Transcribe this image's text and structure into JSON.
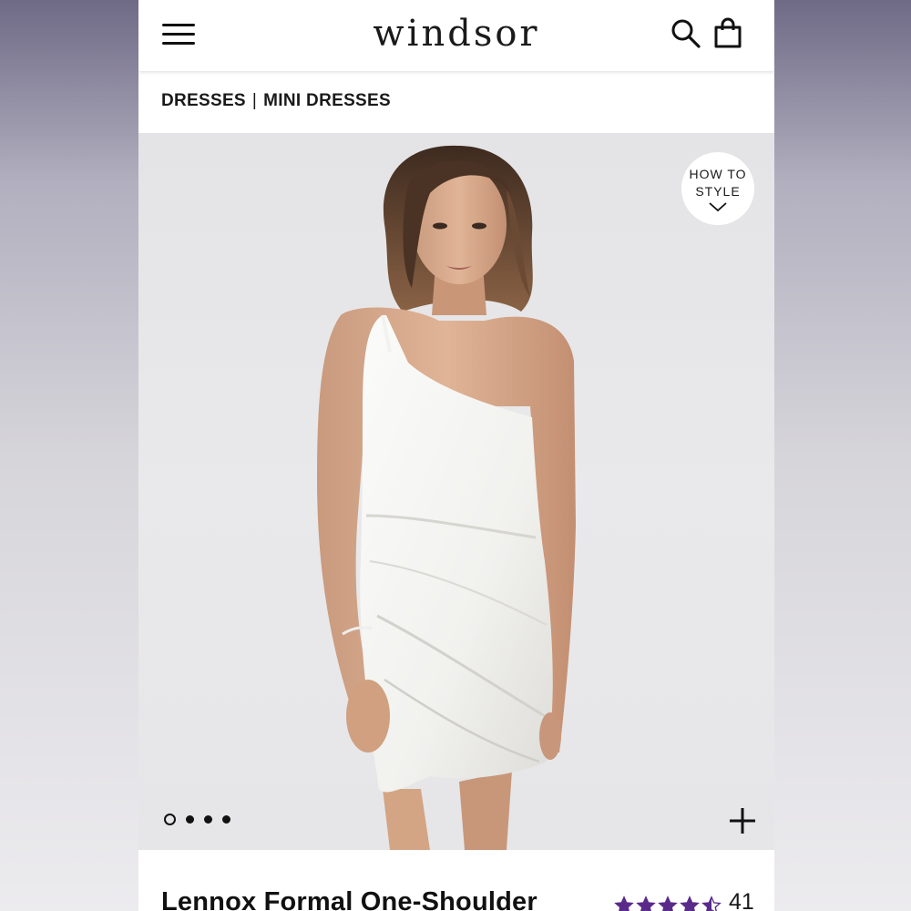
{
  "header": {
    "brand": "windsor",
    "menu_icon": "hamburger-menu-icon",
    "search_icon": "search-icon",
    "bag_icon": "shopping-bag-icon"
  },
  "breadcrumb": {
    "items": [
      "DRESSES",
      "MINI DRESSES"
    ],
    "separator": "|"
  },
  "product_image": {
    "how_to_style_line1": "HOW TO",
    "how_to_style_line2": "STYLE",
    "carousel": {
      "total": 4,
      "active": 0
    },
    "zoom_icon": "plus-icon"
  },
  "product": {
    "title": "Lennox Formal One-Shoulder",
    "rating": 4.5,
    "review_count": "41",
    "star_color": "#5a2a8a"
  }
}
